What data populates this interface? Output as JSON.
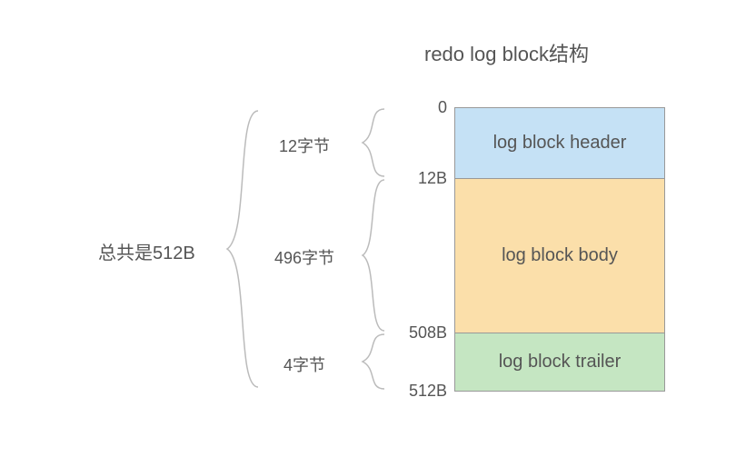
{
  "title": "redo log block结构",
  "total_label": "总共是512B",
  "sections": {
    "header": {
      "size_label": "12字节",
      "name": "log block header"
    },
    "body": {
      "size_label": "496字节",
      "name": "log block body"
    },
    "trailer": {
      "size_label": "4字节",
      "name": "log block trailer"
    }
  },
  "offsets": {
    "o0": "0",
    "o12": "12B",
    "o508": "508B",
    "o512": "512B"
  },
  "chart_data": {
    "type": "table",
    "title": "redo log block结构",
    "total_bytes": 512,
    "segments": [
      {
        "name": "log block header",
        "start": 0,
        "end": 12,
        "size_bytes": 12
      },
      {
        "name": "log block body",
        "start": 12,
        "end": 508,
        "size_bytes": 496
      },
      {
        "name": "log block trailer",
        "start": 508,
        "end": 512,
        "size_bytes": 4
      }
    ]
  }
}
